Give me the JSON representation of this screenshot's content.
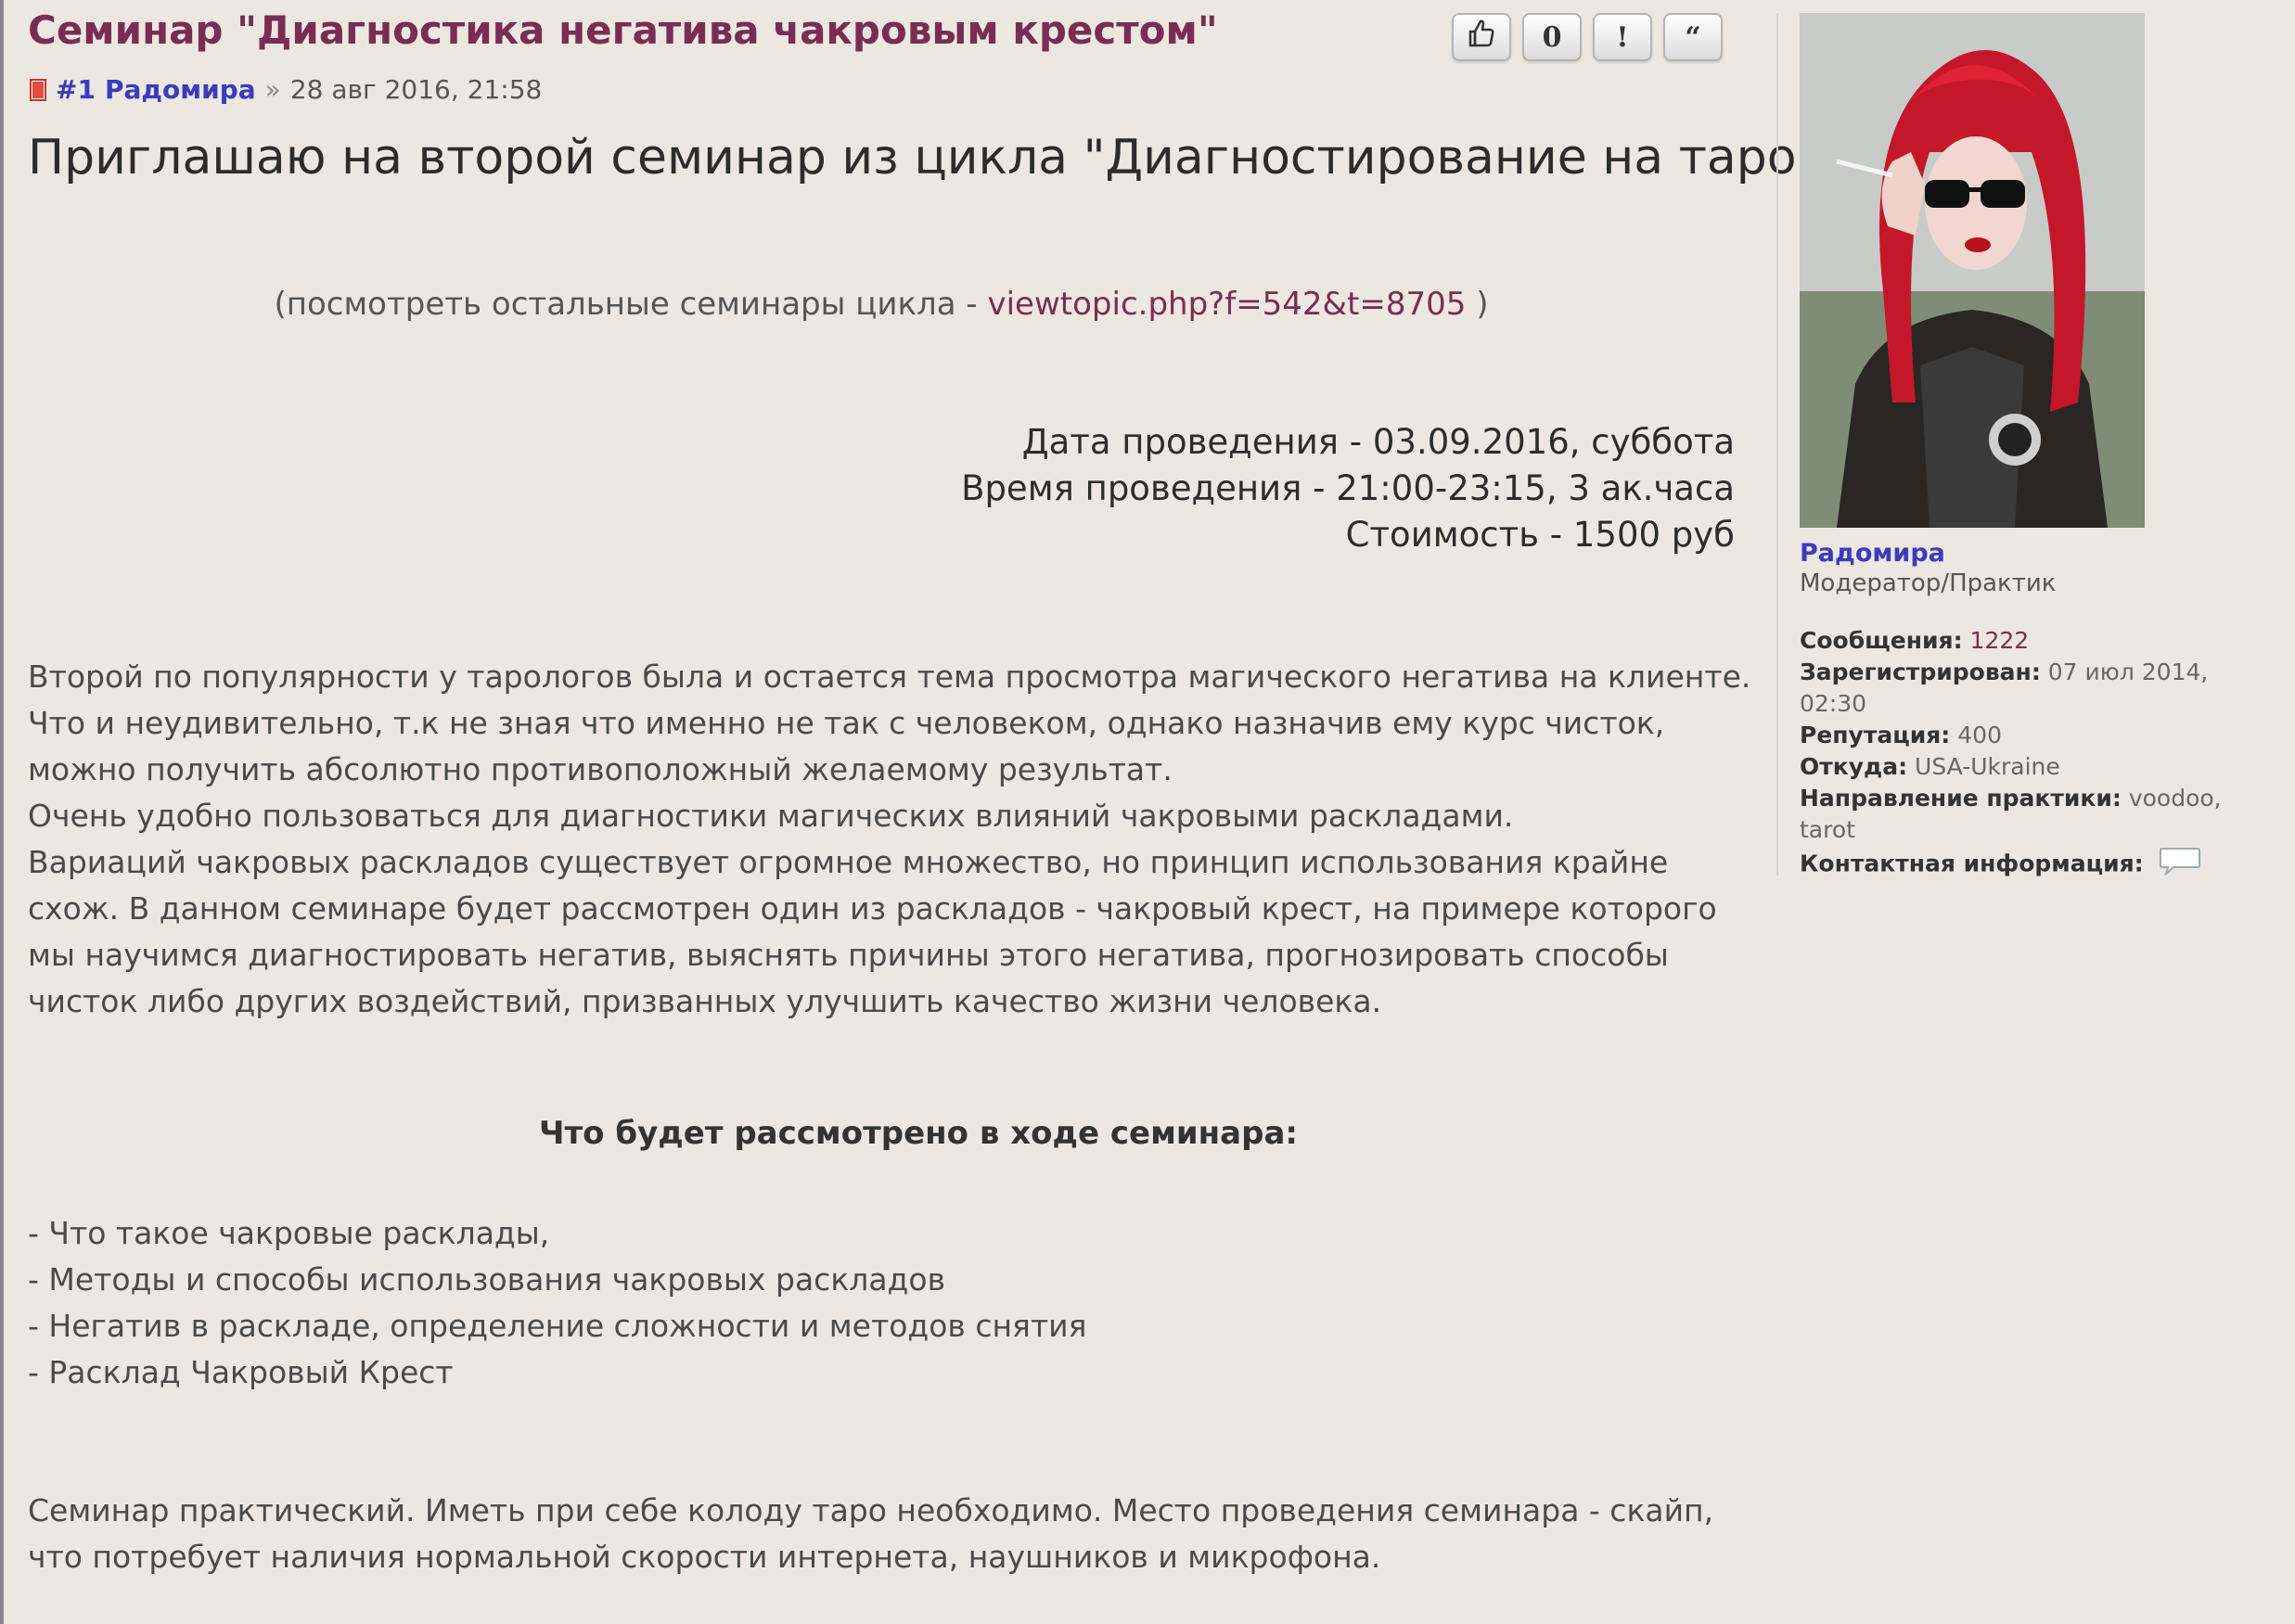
{
  "post": {
    "title": "Семинар \"Диагностика негатива чакровым крестом\"",
    "number": "#1",
    "author": "Радомира",
    "separator": "»",
    "date": "28 авг 2016, 21:58",
    "buttons": [
      {
        "name": "like-button",
        "icon": "thumb-icon",
        "label": ""
      },
      {
        "name": "rating-button",
        "icon": "",
        "label": "0"
      },
      {
        "name": "report-button",
        "icon": "",
        "label": "!"
      },
      {
        "name": "quote-button",
        "icon": "",
        "label": "“"
      }
    ],
    "headline": "Приглашаю на второй семинар из цикла \"Диагностирование на таро\"",
    "subline_prefix": "(посмотреть остальные семинары цикла - ",
    "subline_link": "viewtopic.php?f=542&t=8705",
    "subline_suffix": " )",
    "event_date": "Дата проведения - 03.09.2016, суббота",
    "event_time": "Время проведения - 21:00-23:15, 3 ак.часа",
    "event_cost": "Стоимость - 1500 руб",
    "paragraphs": [
      "Второй по популярности у тарологов была и остается тема просмотра магического негатива на клиенте. Что и неудивительно, т.к не зная что именно не так с человеком, однако назначив ему курс чисток, можно получить абсолютно противоположный желаемому результат.",
      "Очень удобно пользоваться для диагностики магических влияний чакровыми раскладами.",
      "Вариаций чакровых раскладов существует огромное множество, но принцип использования крайне схож. В данном семинаре будет рассмотрен один из раскладов - чакровый крест, на примере которого мы научимся диагностировать негатив, выяснять причины этого негатива, прогнозировать способы чисток либо других воздействий, призванных улучшить качество жизни человека."
    ],
    "section_title": "Что будет рассмотрено в ходе семинара:",
    "topics": [
      "- Что такое чакровые расклады,",
      "- Методы и способы использования чакровых раскладов",
      "- Негатив в раскладе, определение сложности и методов снятия",
      "- Расклад Чакровый Крест"
    ],
    "final": "Семинар практический. Иметь при себе колоду таро необходимо. Место проведения семинара - скайп, что потребует наличия нормальной скорости интернета, наушников и микрофона."
  },
  "profile": {
    "username": "Радомира",
    "rank": "Модератор/Практик",
    "stats": [
      {
        "label": "Сообщения:",
        "value": "1222"
      },
      {
        "label": "Зарегистрирован:",
        "value": "07 июл 2014, 02:30"
      },
      {
        "label": "Репутация:",
        "value": "400"
      },
      {
        "label": "Откуда:",
        "value": "USA-Ukraine"
      },
      {
        "label": "Направление практики:",
        "value": "voodoo, tarot"
      },
      {
        "label": "Контактная информация:",
        "value": ""
      }
    ]
  },
  "colors": {
    "title": "#7a2d52",
    "username": "#3b3bbf",
    "background": "#ece8e1"
  }
}
